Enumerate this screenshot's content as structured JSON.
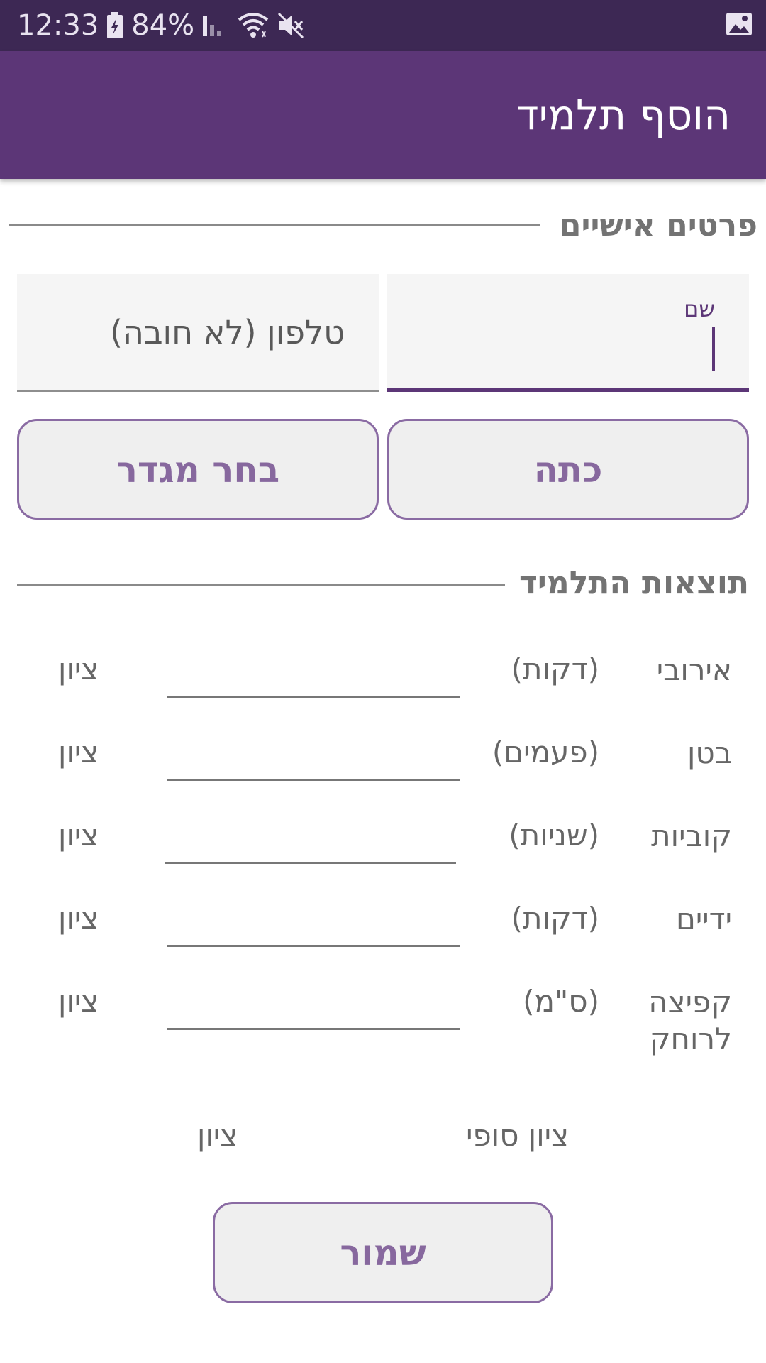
{
  "status_bar": {
    "time": "12:33",
    "battery": "84%",
    "icons": [
      "battery-charging-icon",
      "signal-icon",
      "wifi-icon",
      "mute-icon",
      "image-icon"
    ]
  },
  "app_bar": {
    "title": "הוסף תלמיד"
  },
  "personal": {
    "section_title": "פרטים אישיים",
    "name_label": "שם",
    "name_value": "",
    "phone_placeholder": "טלפון (לא חובה)",
    "class_button": "כתה",
    "gender_button": "בחר מגדר"
  },
  "results": {
    "section_title": "תוצאות התלמיד",
    "rows": [
      {
        "label": "אירובי",
        "unit": "(דקות)",
        "value": "",
        "grade": "ציון"
      },
      {
        "label": "בטן",
        "unit": "(פעמים)",
        "value": "",
        "grade": "ציון"
      },
      {
        "label": "קוביות",
        "unit": "(שניות)",
        "value": "",
        "grade": "ציון"
      },
      {
        "label": "ידיים",
        "unit": "(דקות)",
        "value": "",
        "grade": "ציון"
      },
      {
        "label": "קפיצה לרוחק",
        "unit": "(ס\"מ)",
        "value": "",
        "grade": "ציון"
      }
    ],
    "final_label": "ציון סופי",
    "final_grade": "ציון"
  },
  "save_button": "שמור",
  "colors": {
    "primary": "#5c3677",
    "primary_dark": "#3d2854",
    "button_text": "#87689e",
    "button_border": "#8a6ba3"
  }
}
